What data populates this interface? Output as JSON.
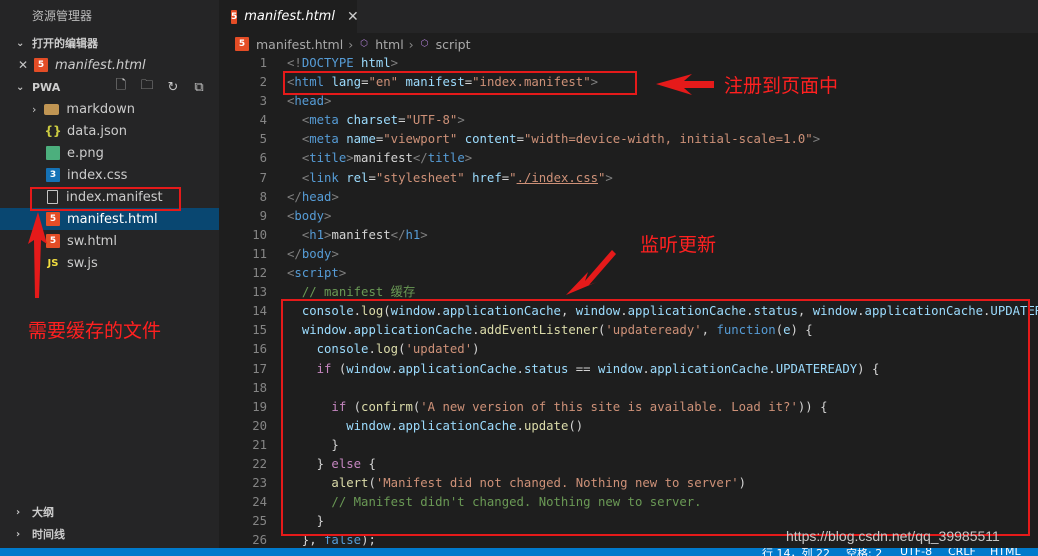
{
  "sidebar": {
    "title": "资源管理器",
    "open_editors": {
      "header": "打开的编辑器",
      "items": [
        {
          "name": "manifest.html",
          "icon": "html5-icon"
        }
      ]
    },
    "folder": {
      "name": "PWA",
      "items": [
        {
          "name": "markdown",
          "icon": "folder-icon"
        },
        {
          "name": "data.json",
          "icon": "json-icon"
        },
        {
          "name": "e.png",
          "icon": "image-icon"
        },
        {
          "name": "index.css",
          "icon": "css3-icon"
        },
        {
          "name": "index.manifest",
          "icon": "file-icon"
        },
        {
          "name": "manifest.html",
          "icon": "html5-icon",
          "selected": true
        },
        {
          "name": "sw.html",
          "icon": "html5-icon"
        },
        {
          "name": "sw.js",
          "icon": "js-icon",
          "glyph": "JS"
        }
      ]
    },
    "outline": "大纲",
    "timeline": "时间线"
  },
  "editor": {
    "tab": {
      "label": "manifest.html",
      "close_glyph": "✕"
    },
    "breadcrumb": [
      "manifest.html",
      "html",
      "script"
    ],
    "line_numbers": [
      "1",
      "2",
      "3",
      "4",
      "5",
      "6",
      "7",
      "8",
      "9",
      "10",
      "11",
      "12",
      "13",
      "14",
      "15",
      "16",
      "17",
      "18",
      "19",
      "20",
      "21",
      "22",
      "23",
      "24",
      "25",
      "26"
    ]
  },
  "annotations": {
    "register": "注册到页面中",
    "cache_files": "需要缓存的文件",
    "listen_update": "监听更新"
  },
  "status": {
    "items": [
      "行 14，列 22",
      "空格: 2",
      "UTF-8",
      "CRLF",
      "HTML"
    ]
  },
  "watermark": "https://blog.csdn.net/qq_39985511",
  "colors": {
    "accent": "#007acc",
    "annotation_red": "#e51a1a",
    "selected_row": "#094771"
  }
}
